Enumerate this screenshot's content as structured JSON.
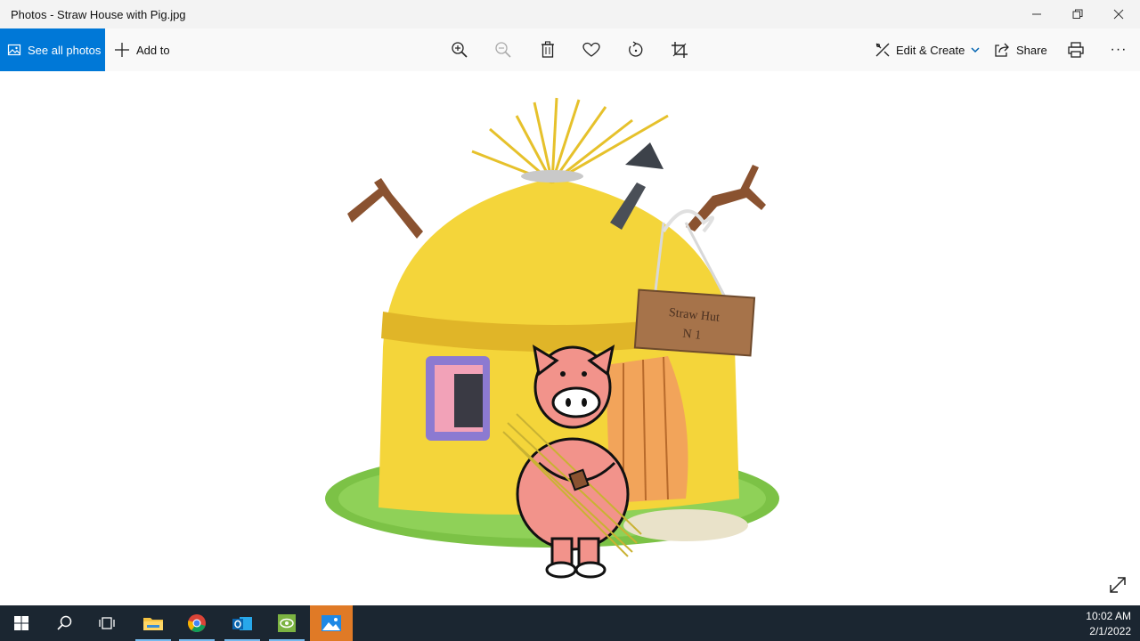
{
  "window": {
    "title": "Photos - Straw House with Pig.jpg"
  },
  "toolbar": {
    "see_all_label": "See all photos",
    "add_to_label": "Add to",
    "edit_create_label": "Edit & Create",
    "share_label": "Share",
    "more_label": "···"
  },
  "icons": {
    "zoom_in": "zoom-in-icon",
    "zoom_out": "zoom-out-icon",
    "delete": "trash-icon",
    "favorite": "heart-icon",
    "rotate": "rotate-icon",
    "crop": "crop-icon",
    "print": "print-icon"
  },
  "photo": {
    "sign_text_line1": "Straw Hut",
    "sign_text_line2": "N 1"
  },
  "taskbar": {
    "time": "10:02 AM",
    "date": "2/1/2022"
  },
  "colors": {
    "accent": "#0078d7",
    "taskbar": "#1b2631",
    "active_app": "#e07a26"
  }
}
